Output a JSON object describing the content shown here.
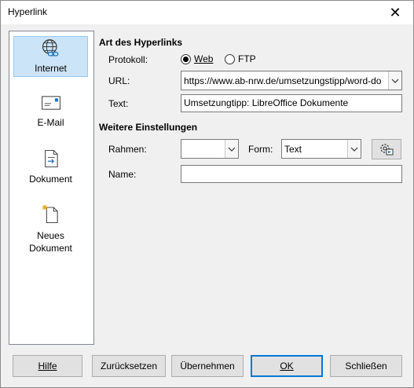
{
  "window": {
    "title": "Hyperlink",
    "close_glyph": "✕"
  },
  "sidebar": {
    "items": [
      {
        "label": "Internet",
        "icon": "globe-link-icon",
        "selected": true
      },
      {
        "label": "E-Mail",
        "icon": "envelope-icon",
        "selected": false
      },
      {
        "label": "Dokument",
        "icon": "document-arrow-icon",
        "selected": false
      },
      {
        "label_line1": "Neues",
        "label_line2": "Dokument",
        "icon": "new-document-icon",
        "selected": false
      }
    ]
  },
  "hyperlink_type": {
    "title": "Art des Hyperlinks",
    "protocol_label": "Protokoll:",
    "web_label": "Web",
    "ftp_label": "FTP",
    "selected_protocol": "Web",
    "url_label": "URL:",
    "url_value": "https://www.ab-nrw.de/umsetzungstipp/word-do",
    "text_label": "Text:",
    "text_value": "Umsetzungtipp: LibreOffice Dokumente"
  },
  "further_settings": {
    "title": "Weitere Einstellungen",
    "frame_label": "Rahmen:",
    "frame_value": "",
    "form_label": "Form:",
    "form_value": "Text",
    "name_label": "Name:",
    "name_value": ""
  },
  "buttons": {
    "help": "Hilfe",
    "reset": "Zurücksetzen",
    "apply": "Übernehmen",
    "ok": "OK",
    "close": "Schließen"
  }
}
